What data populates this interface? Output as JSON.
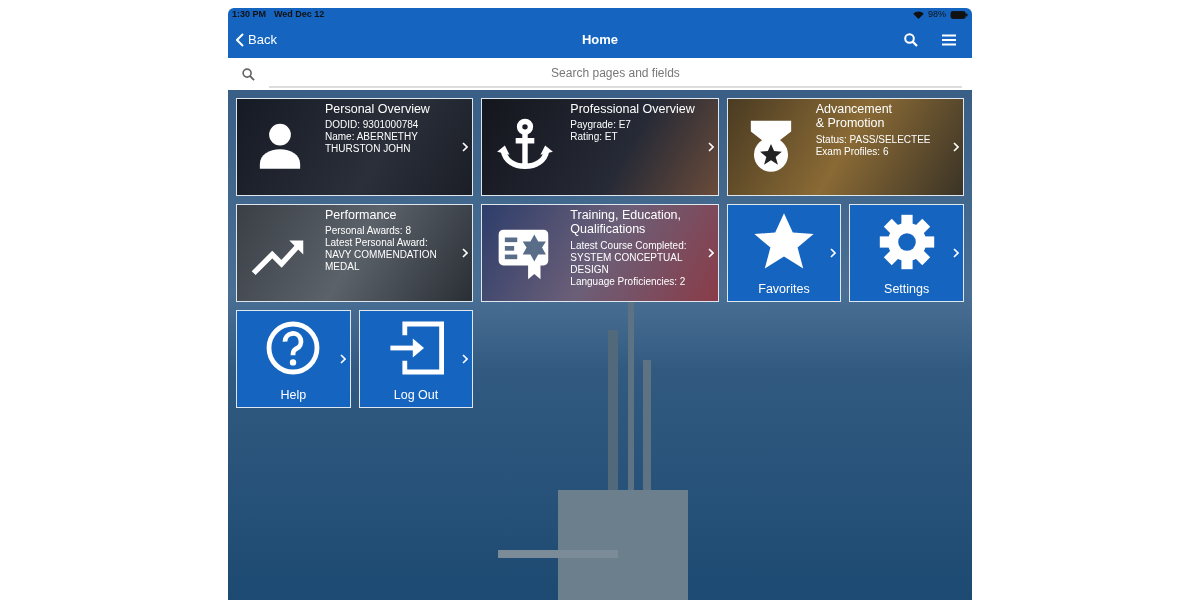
{
  "status_bar": {
    "time": "1:30 PM",
    "date": "Wed Dec 12",
    "battery": "98%"
  },
  "nav": {
    "back": "Back",
    "title": "Home"
  },
  "search": {
    "placeholder": "Search pages and fields"
  },
  "tiles": [
    {
      "kind": "photo",
      "title": [
        "Personal Overview"
      ],
      "lines": [
        "DODID: 9301000784",
        "Name: ABERNETHY THURSTON JOHN"
      ]
    },
    {
      "kind": "photo",
      "title": [
        "Professional Overview"
      ],
      "lines": [
        "Paygrade: E7",
        "Rating: ET"
      ]
    },
    {
      "kind": "photo",
      "title": [
        "Advancement",
        "& Promotion"
      ],
      "lines": [
        "Status: PASS/SELECTEE",
        "Exam Profiles: 6"
      ]
    },
    {
      "kind": "photo",
      "title": [
        "Performance"
      ],
      "lines": [
        "Personal Awards: 8",
        "Latest Personal Award: NAVY COMMENDATION MEDAL"
      ]
    },
    {
      "kind": "photo",
      "title": [
        "Training, Education, Qualifications"
      ],
      "lines": [
        "Latest Course Completed: SYSTEM CONCEPTUAL DESIGN",
        "Language Proficiencies: 2"
      ]
    },
    {
      "kind": "plain",
      "title": [
        "Favorites"
      ]
    },
    {
      "kind": "plain",
      "title": [
        "Settings"
      ]
    },
    {
      "kind": "plain",
      "title": [
        "Help"
      ]
    },
    {
      "kind": "plain",
      "title": [
        "Log Out"
      ]
    }
  ]
}
